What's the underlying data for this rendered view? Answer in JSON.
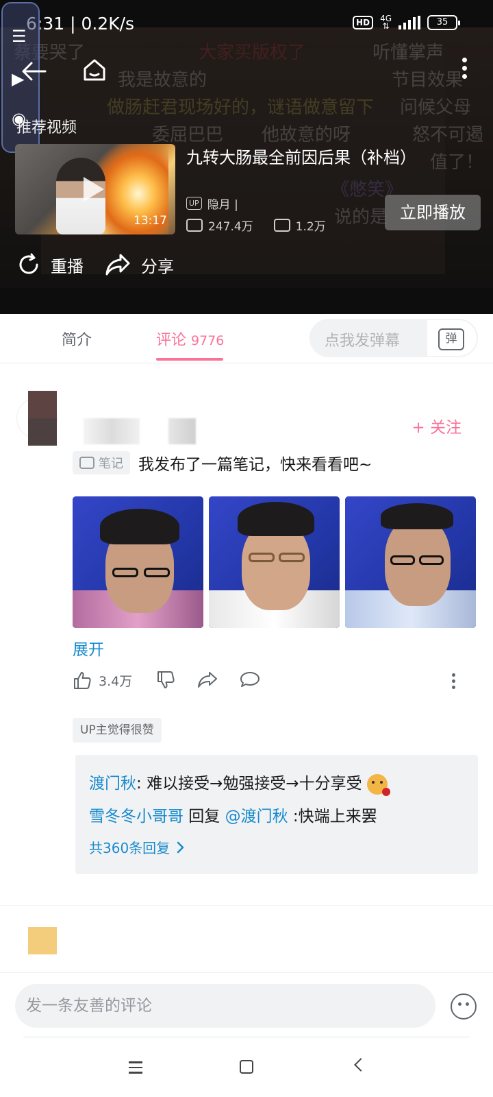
{
  "status_bar": {
    "time_speed": "6:31 | 0.2K/s",
    "hd": "HD",
    "network": "4G",
    "battery": "35"
  },
  "player": {
    "danmaku": [
      {
        "text": "蔡要哭了"
      },
      {
        "text": "大家买版权了"
      },
      {
        "text": "听懂掌声"
      },
      {
        "text": "我是故意的"
      },
      {
        "text": "节目效果"
      },
      {
        "text": "做肠赶君现场好的，谜语做意留下"
      },
      {
        "text": "问候父母"
      },
      {
        "text": "委屈巴巴"
      },
      {
        "text": "他故意的呀"
      },
      {
        "text": "怒不可遏"
      },
      {
        "text": "值了！"
      },
      {
        "text": "《憋笑》"
      },
      {
        "text": "说的是"
      }
    ],
    "recommend_label": "推荐视频",
    "rec_video": {
      "title": "九转大肠最全前因后果（补档）",
      "duration": "13:17",
      "up_badge": "UP",
      "up_name": "隐月 |",
      "views": "247.4万",
      "danmaku_count": "1.2万",
      "play_now": "立即播放"
    },
    "replay": "重播",
    "share": "分享"
  },
  "tabs": {
    "intro": "简介",
    "comments": "评论",
    "comment_count": "9776",
    "danmu_placeholder": "点我发弹幕",
    "danmu_icon_text": "弹"
  },
  "comment": {
    "follow": "+ 关注",
    "note_tag": "笔记",
    "text": "我发布了一篇笔记，快来看看吧~",
    "expand": "展开",
    "likes": "3.4万",
    "up_liked": "UP主觉得很赞",
    "replies": [
      {
        "name": "渡门秋",
        "sep": ": ",
        "text": "难以接受→勉强接受→十分享受"
      },
      {
        "name": "雪冬冬小哥哥",
        "sep": " 回复 ",
        "mention": "@渡门秋",
        "text": " :快端上来罢"
      }
    ],
    "more_replies": "共360条回复"
  },
  "bottom": {
    "input_placeholder": "发一条友善的评论"
  }
}
